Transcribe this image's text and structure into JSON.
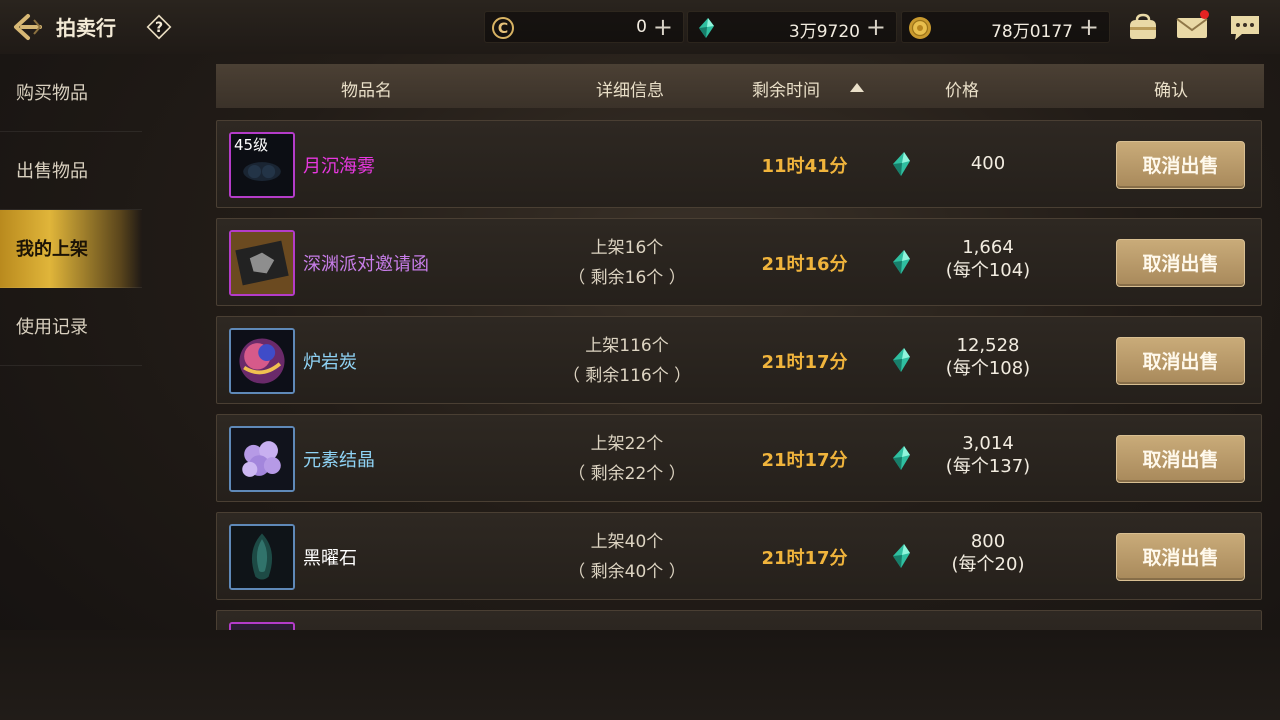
{
  "header": {
    "title": "拍卖行",
    "back_icon": "back-arrow-icon",
    "help_icon": "question-diamond-icon",
    "currencies": [
      {
        "name": "coupon",
        "icon": "c-coin-icon",
        "value": "0"
      },
      {
        "name": "gem",
        "icon": "green-gem-icon",
        "value": "3万9720"
      },
      {
        "name": "gold",
        "icon": "gold-coin-icon",
        "value": "78万0177"
      }
    ],
    "tools": [
      {
        "icon": "bag-icon"
      },
      {
        "icon": "mail-icon",
        "has_notification": true
      },
      {
        "icon": "chat-icon"
      }
    ]
  },
  "sidebar": {
    "items": [
      {
        "label": "购买物品",
        "active": false
      },
      {
        "label": "出售物品",
        "active": false
      },
      {
        "label": "我的上架",
        "active": true
      },
      {
        "label": "使用记录",
        "active": false
      }
    ]
  },
  "table": {
    "headers": {
      "name": "物品名",
      "detail": "详细信息",
      "time": "剩余时间",
      "price": "价格",
      "confirm": "确认"
    },
    "sort": {
      "column": "time",
      "direction": "ascending"
    },
    "rows": [
      {
        "level": "45级",
        "name": "月沉海雾",
        "name_color": "#e838e0",
        "detail1": "",
        "detail2": "",
        "time": "11时41分",
        "price": "400",
        "unit_price": "",
        "button": "取消出售"
      },
      {
        "level": "",
        "name": "深渊派对邀请函",
        "name_color": "#c77de8",
        "detail1": "上架16个",
        "detail2": "（ 剩余16个 ）",
        "time": "21时16分",
        "price": "1,664",
        "unit_price": "(每个104)",
        "button": "取消出售"
      },
      {
        "level": "",
        "name": "炉岩炭",
        "name_color": "#8fd3f5",
        "detail1": "上架116个",
        "detail2": "（ 剩余116个 ）",
        "time": "21时17分",
        "price": "12,528",
        "unit_price": "(每个108)",
        "button": "取消出售"
      },
      {
        "level": "",
        "name": "元素结晶",
        "name_color": "#8fd3f5",
        "detail1": "上架22个",
        "detail2": "（ 剩余22个 ）",
        "time": "21时17分",
        "price": "3,014",
        "unit_price": "(每个137)",
        "button": "取消出售"
      },
      {
        "level": "",
        "name": "黑曜石",
        "name_color": "#ffffff",
        "detail1": "上架40个",
        "detail2": "（ 剩余40个 ）",
        "time": "21时17分",
        "price": "800",
        "unit_price": "(每个20)",
        "button": "取消出售"
      }
    ]
  },
  "colors": {
    "accent_gold": "#e0b53a",
    "time_orange": "#f0b43c",
    "button": "#b89968"
  }
}
